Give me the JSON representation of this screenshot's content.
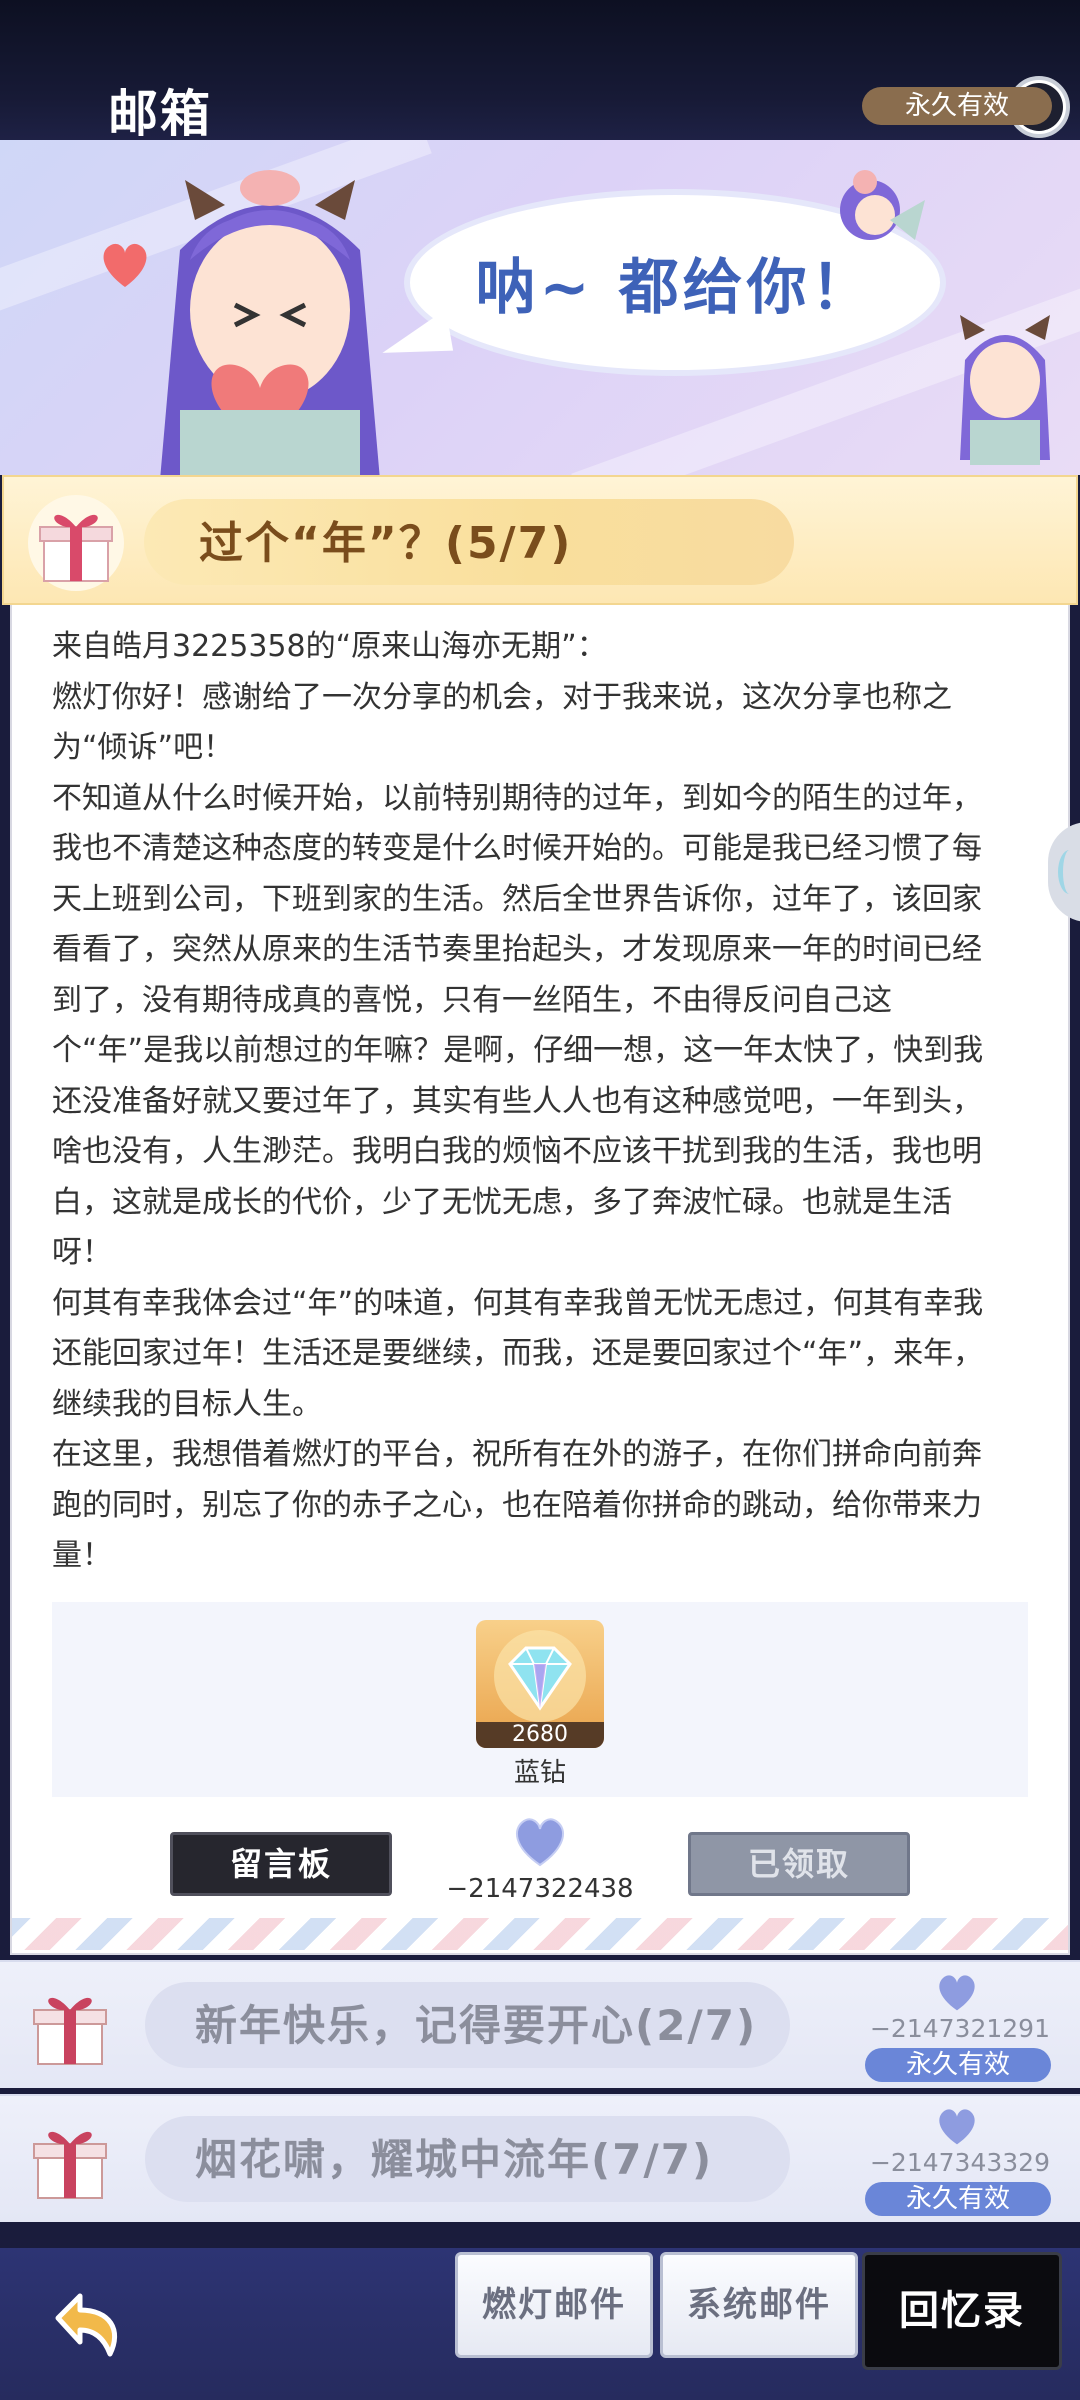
{
  "header": {
    "title": "邮箱",
    "help_icon": "question-icon"
  },
  "banner": {
    "speech": "呐~ 都给你！"
  },
  "open_mail": {
    "title": "过个“年”？(5/7)",
    "validity": "永久有效",
    "letter": [
      "来自皓月3225358的“原来山海亦无期”：",
      "燃灯你好！感谢给了一次分享的机会，对于我来说，这次分享也称之为“倾诉”吧！",
      "不知道从什么时候开始，以前特别期待的过年，到如今的陌生的过年，我也不清楚这种态度的转变是什么时候开始的。可能是我已经习惯了每天上班到公司，下班到家的生活。然后全世界告诉你，过年了，该回家看看了，突然从原来的生活节奏里抬起头，才发现原来一年的时间已经到了，没有期待成真的喜悦，只有一丝陌生，不由得反问自己这个“年”是我以前想过的年嘛？是啊，仔细一想，这一年太快了，快到我还没准备好就又要过年了，其实有些人人也有这种感觉吧，一年到头，啥也没有，人生渺茫。我明白我的烦恼不应该干扰到我的生活，我也明白，这就是成长的代价，少了无忧无虑，多了奔波忙碌。也就是生活呀！",
      "何其有幸我体会过“年”的味道，何其有幸我曾无忧无虑过，何其有幸我还能回家过年！生活还是要继续，而我，还是要回家过个“年”，来年，继续我的目标人生。",
      "在这里，我想借着燃灯的平台，祝所有在外的游子，在你们拼命向前奔跑的同时，别忘了你的赤子之心，也在陪着你拼命的跳动，给你带来力量！"
    ],
    "reward": {
      "count": "2680",
      "name": "蓝钻",
      "icon": "blue-diamond-icon"
    },
    "message_board_label": "留言板",
    "likes": "−2147322438",
    "claimed_label": "已领取"
  },
  "mail_list": [
    {
      "title": "新年快乐，记得要开心(2/7)",
      "likes": "−2147321291",
      "validity": "永久有效"
    },
    {
      "title": "烟花啸，耀城中流年(7/7)",
      "likes": "−2147343329",
      "validity": "永久有效"
    }
  ],
  "bottom_nav": {
    "tabs": [
      "燃灯邮件",
      "系统邮件",
      "回忆录"
    ],
    "active": "回忆录"
  },
  "colors": {
    "accent_blue": "#3e62b8",
    "valid_blue": "#6a86d8",
    "valid_brown": "#8a6d4e"
  }
}
